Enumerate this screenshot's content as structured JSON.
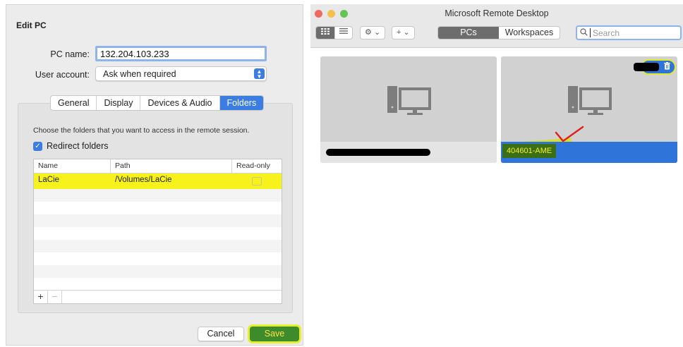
{
  "edit_pc": {
    "title": "Edit PC",
    "pc_name_label": "PC name:",
    "pc_name_value": "132.204.103.233",
    "user_account_label": "User account:",
    "user_account_value": "Ask when required",
    "tabs": [
      {
        "label": "General",
        "active": false
      },
      {
        "label": "Display",
        "active": false
      },
      {
        "label": "Devices & Audio",
        "active": false
      },
      {
        "label": "Folders",
        "active": true
      }
    ],
    "folders_description": "Choose the folders that you want to access in the remote session.",
    "redirect_folders_label": "Redirect folders",
    "redirect_folders_checked": true,
    "table": {
      "columns": [
        "Name",
        "Path",
        "Read-only"
      ],
      "rows": [
        {
          "name": "LaCie",
          "path": "/Volumes/LaCie",
          "read_only": false
        }
      ]
    },
    "add_symbol": "+",
    "remove_symbol": "−",
    "cancel_label": "Cancel",
    "save_label": "Save"
  },
  "remote_desktop": {
    "title": "Microsoft Remote Desktop",
    "segments": [
      {
        "label": "PCs",
        "selected": true
      },
      {
        "label": "Workspaces",
        "selected": false
      }
    ],
    "search_placeholder": "Search",
    "pcs": [
      {
        "label": ""
      },
      {
        "label": "404601-AME"
      }
    ]
  },
  "icons": {
    "grid_view": "grid-view-icon",
    "list_view": "list-view-icon",
    "settings": "gear-icon",
    "add": "plus-icon",
    "search": "search-icon",
    "delete": "trash-icon",
    "pc": "desktop-computer-icon"
  },
  "colors": {
    "accent_blue": "#3b7de0",
    "highlight_yellow": "#f7f21c",
    "save_green": "#3d8b2a"
  }
}
